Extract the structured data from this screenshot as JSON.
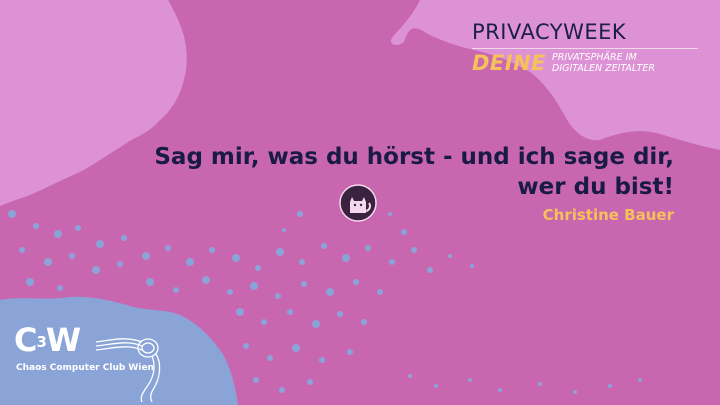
{
  "colors": {
    "background": "#c966b0",
    "light_land": "#dd92d6",
    "blue_patch": "#8aa4d8",
    "title": "#1a1b45",
    "speaker": "#f5c15a",
    "brand_yellow": "#f5c15a",
    "brand_dark": "#1b1f4a"
  },
  "brand": {
    "title": "PRIVACYWEEK",
    "deine": "DEINE",
    "subtitle_line1": "PRIVATSPHÄRE IM",
    "subtitle_line2": "DIGITALEN ZEITALTER"
  },
  "talk": {
    "title_line1": "Sag mir, was du hörst - und ich sage dir,",
    "title_line2": "wer du bist!",
    "speaker": "Christine Bauer"
  },
  "logo": {
    "icon": "cat-icon"
  },
  "footer": {
    "c3w_mark": "C",
    "c3w_sup": "3",
    "c3w_w": "W",
    "caption": "Chaos Computer Club Wien",
    "icon": "rope-knot-icon"
  }
}
